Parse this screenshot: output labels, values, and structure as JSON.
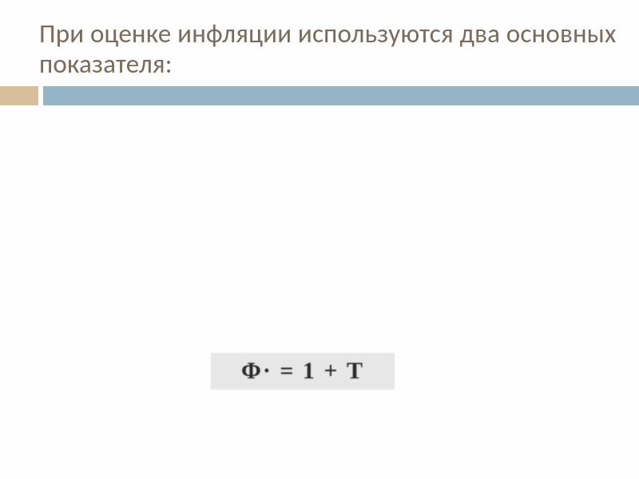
{
  "slide": {
    "title": "При оценке инфляции используются два основных показателя:",
    "formula": "Φ· = 1 + Т"
  },
  "colors": {
    "title_text": "#7a6b5c",
    "accent_box": "#d8be99",
    "divider_bar": "#95b4c6",
    "formula_bg": "#e7e7e7"
  }
}
